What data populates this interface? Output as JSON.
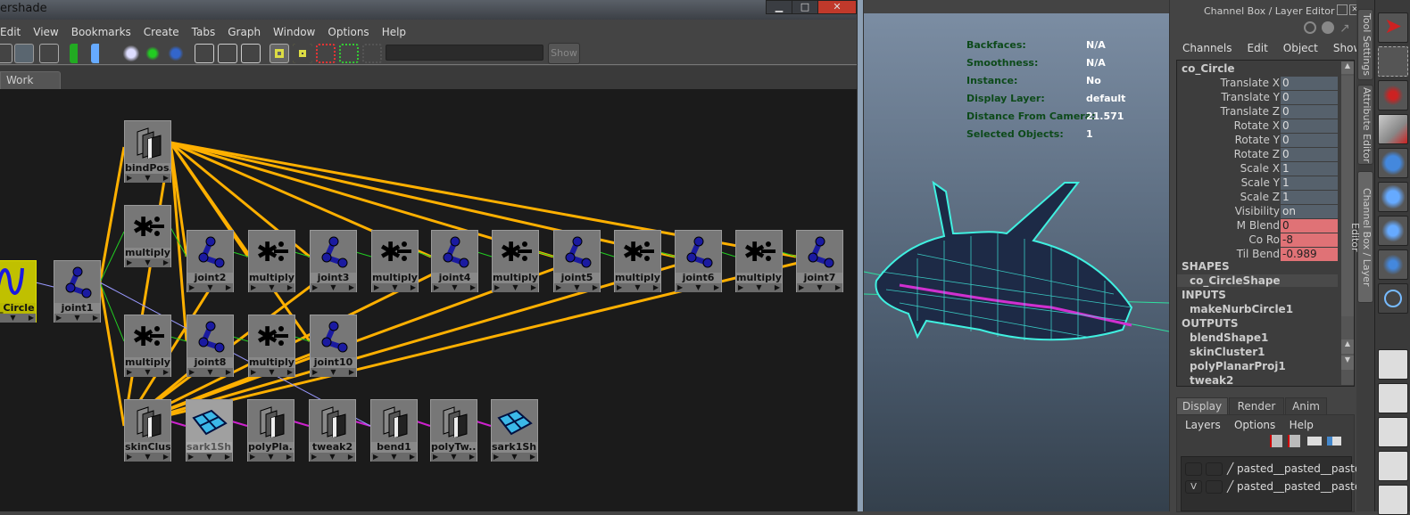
{
  "window": {
    "title": "ershade",
    "minimize": "▁",
    "maximize": "□",
    "close": "✕"
  },
  "menu": [
    "Edit",
    "View",
    "Bookmarks",
    "Create",
    "Tabs",
    "Graph",
    "Window",
    "Options",
    "Help"
  ],
  "toolbar": {
    "search_value": "",
    "show_label": "Show"
  },
  "tabs": {
    "work_area": "Work Area"
  },
  "nodes": {
    "co_circle": "o_Circle",
    "joint1": "joint1",
    "bindpose": "bindPos...",
    "mult_a": "multiply...",
    "joint2": "joint2",
    "mult_b": "multiply...",
    "joint3": "joint3",
    "mult_c": "multiply...",
    "joint4": "joint4",
    "mult_d": "multiply...",
    "joint5": "joint5",
    "mult_e": "multiply...",
    "joint6": "joint6",
    "mult_f": "multiply...",
    "joint7": "joint7",
    "mult_g": "multiply...",
    "joint8": "joint8",
    "mult_h": "multiply...",
    "joint10": "joint10",
    "skincluster": "skinClus...",
    "sark_a": "sark1Sh...",
    "polyplanar": "polyPla...",
    "tweak2": "tweak2",
    "bend1": "bend1",
    "polytweak": "polyTw...",
    "sark_b": "sark1Sh..."
  },
  "viewport": {
    "hud": [
      {
        "k": "Backfaces:",
        "v": "N/A"
      },
      {
        "k": "Smoothness:",
        "v": "N/A"
      },
      {
        "k": "Instance:",
        "v": "No"
      },
      {
        "k": "Display Layer:",
        "v": "default"
      },
      {
        "k": "Distance From Camera:",
        "v": "21.571"
      },
      {
        "k": "Selected Objects:",
        "v": "1"
      }
    ]
  },
  "channel_box": {
    "title": "Channel Box / Layer Editor",
    "menu": [
      "Channels",
      "Edit",
      "Object",
      "Show"
    ],
    "object": "co_Circle",
    "channels": [
      {
        "n": "Translate X",
        "v": "0"
      },
      {
        "n": "Translate Y",
        "v": "0"
      },
      {
        "n": "Translate Z",
        "v": "0"
      },
      {
        "n": "Rotate X",
        "v": "0"
      },
      {
        "n": "Rotate Y",
        "v": "0"
      },
      {
        "n": "Rotate Z",
        "v": "0"
      },
      {
        "n": "Scale X",
        "v": "1"
      },
      {
        "n": "Scale Y",
        "v": "1"
      },
      {
        "n": "Scale Z",
        "v": "1"
      },
      {
        "n": "Visibility",
        "v": "on"
      },
      {
        "n": "M Blend",
        "v": "0"
      },
      {
        "n": "Co Ro",
        "v": "-8"
      },
      {
        "n": "Til Bend",
        "v": "-0.989"
      }
    ],
    "shapes_label": "SHAPES",
    "shapes": [
      "co_CircleShape"
    ],
    "inputs_label": "INPUTS",
    "inputs": [
      "makeNurbCircle1"
    ],
    "outputs_label": "OUTPUTS",
    "outputs": [
      "blendShape1",
      "skinCluster1",
      "polyPlanarProj1",
      "tweak2"
    ]
  },
  "layer_editor": {
    "tabs": [
      "Display",
      "Render",
      "Anim"
    ],
    "menu": [
      "Layers",
      "Options",
      "Help"
    ],
    "layers": [
      {
        "v": "",
        "name": "pasted__pasted__pasted"
      },
      {
        "v": "V",
        "name": "pasted__pasted__pasted"
      }
    ]
  },
  "side_tabs": [
    "Tool Settings",
    "Attribute Editor",
    "Channel Box / Layer Editor"
  ],
  "colors": {
    "connection": "#ffb000",
    "keyed": "#e07276",
    "hud_label": "#0d4a1a"
  }
}
